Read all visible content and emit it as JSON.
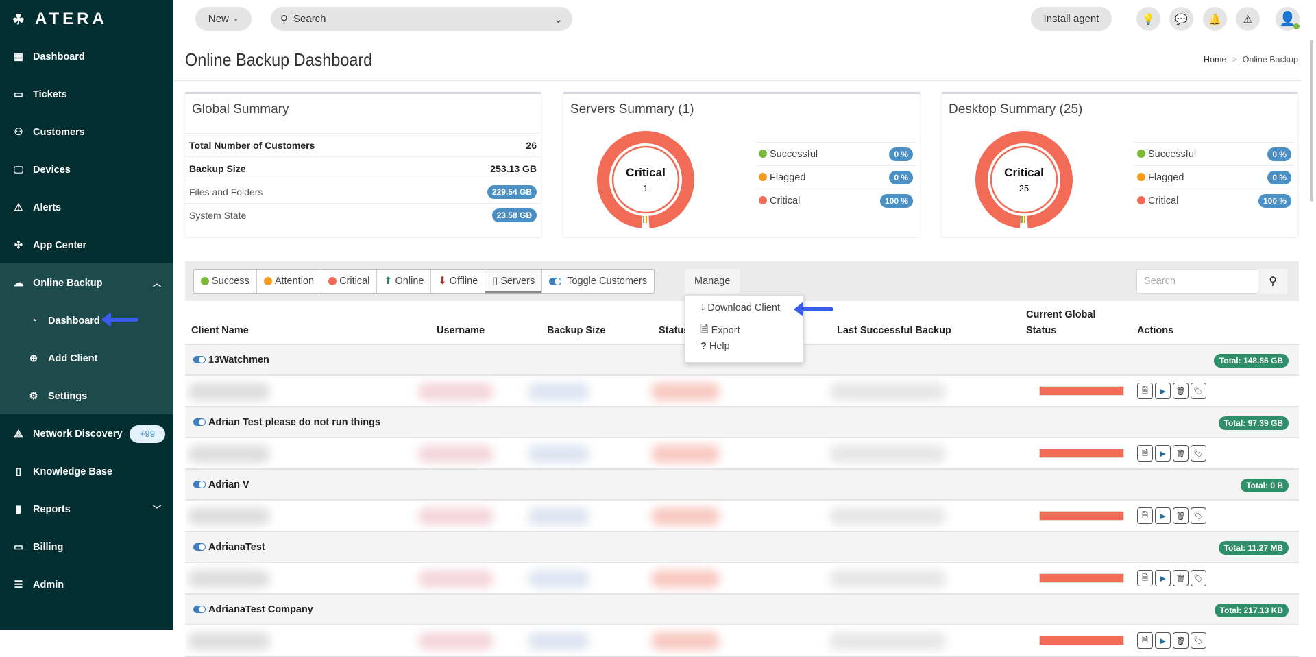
{
  "brand": "ATERA",
  "sidebar": {
    "items": [
      {
        "label": "Dashboard",
        "icon": "dashboard-icon"
      },
      {
        "label": "Tickets",
        "icon": "ticket-icon"
      },
      {
        "label": "Customers",
        "icon": "customers-icon"
      },
      {
        "label": "Devices",
        "icon": "monitor-icon"
      },
      {
        "label": "Alerts",
        "icon": "alert-icon"
      },
      {
        "label": "App Center",
        "icon": "puzzle-icon"
      },
      {
        "label": "Online Backup",
        "icon": "cloud-upload-icon"
      },
      {
        "label": "Dashboard",
        "icon": "gauge-icon",
        "sub": true
      },
      {
        "label": "Add Client",
        "icon": "plus-circle-icon",
        "sub": true
      },
      {
        "label": "Settings",
        "icon": "gear-icon",
        "sub": true
      },
      {
        "label": "Network Discovery",
        "icon": "network-icon",
        "badge": "+99"
      },
      {
        "label": "Knowledge Base",
        "icon": "book-icon"
      },
      {
        "label": "Reports",
        "icon": "bar-chart-icon"
      },
      {
        "label": "Billing",
        "icon": "wallet-icon"
      },
      {
        "label": "Admin",
        "icon": "sliders-icon"
      }
    ]
  },
  "topbar": {
    "new_label": "New",
    "search_placeholder": "Search",
    "install_label": "Install agent"
  },
  "page": {
    "title": "Online Backup Dashboard",
    "breadcrumb": [
      "Home",
      "Online Backup"
    ]
  },
  "global_summary": {
    "title": "Global Summary",
    "rows": [
      {
        "label": "Total Number of Customers",
        "value": "26",
        "bold": true
      },
      {
        "label": "Backup Size",
        "value": "253.13 GB",
        "bold": true
      },
      {
        "label": "Files and Folders",
        "value": "229.54 GB",
        "badge": true
      },
      {
        "label": "System State",
        "value": "23.58 GB",
        "badge": true
      }
    ]
  },
  "servers_summary": {
    "title": "Servers Summary (1)",
    "center_label": "Critical",
    "center_value": "1",
    "legend": [
      {
        "label": "Successful",
        "value": "0 %",
        "color": "#7cb83a"
      },
      {
        "label": "Flagged",
        "value": "0 %",
        "color": "#f39c1f"
      },
      {
        "label": "Critical",
        "value": "100 %",
        "color": "#f26b56"
      }
    ]
  },
  "desktop_summary": {
    "title": "Desktop Summary (25)",
    "center_label": "Critical",
    "center_value": "25",
    "legend": [
      {
        "label": "Successful",
        "value": "0 %",
        "color": "#7cb83a"
      },
      {
        "label": "Flagged",
        "value": "0 %",
        "color": "#f39c1f"
      },
      {
        "label": "Critical",
        "value": "100 %",
        "color": "#f26b56"
      }
    ]
  },
  "filters": [
    "Success",
    "Attention",
    "Critical",
    "Online",
    "Offline",
    "Servers",
    "Toggle Customers"
  ],
  "manage": {
    "label": "Manage",
    "items": [
      "Download Client",
      "Export",
      "Help"
    ]
  },
  "table_search_placeholder": "Search",
  "columns": {
    "client": "Client Name",
    "username": "Username",
    "size": "Backup Size",
    "status": "Status",
    "last": "Last Successful Backup",
    "global1": "Current Global",
    "global2": "Status",
    "actions": "Actions"
  },
  "customers": [
    {
      "name": "13Watchmen",
      "total": "Total: 148.86 GB"
    },
    {
      "name": "Adrian Test please do not run things",
      "total": "Total: 97.39 GB"
    },
    {
      "name": "Adrian V",
      "total": "Total: 0 B"
    },
    {
      "name": "AdrianaTest",
      "total": "Total: 11.27 MB"
    },
    {
      "name": "AdrianaTest Company",
      "total": "Total: 217.13 KB"
    }
  ]
}
